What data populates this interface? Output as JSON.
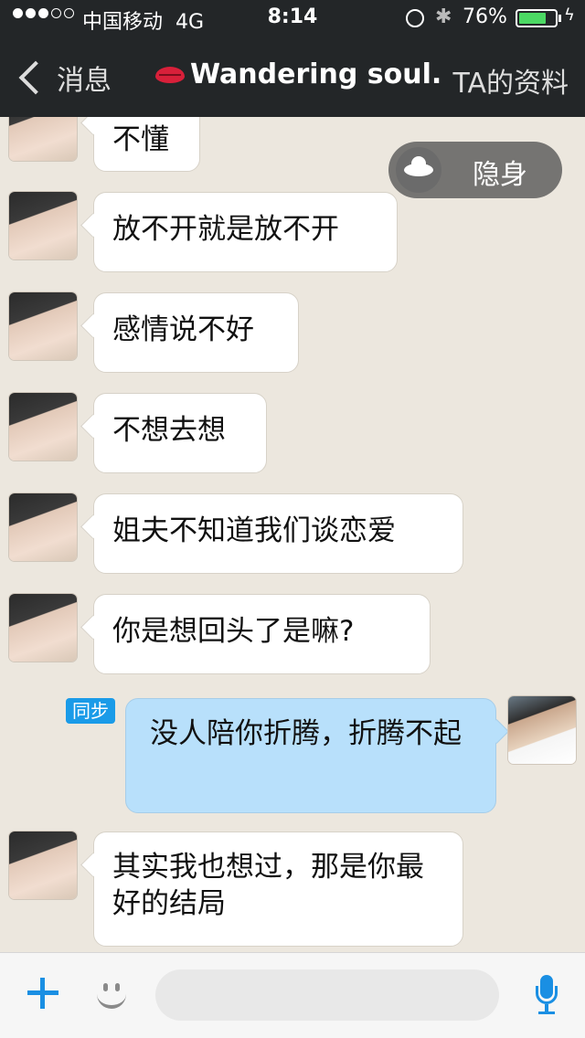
{
  "status_bar": {
    "carrier": "中国移动",
    "network": "4G",
    "time": "8:14",
    "battery": "76%",
    "battery_level": 0.76,
    "signal_bars": 3,
    "signal_total": 5
  },
  "nav": {
    "back_label": "消息",
    "title": "Wandering soul.",
    "right_label": "TA的资料"
  },
  "stealth_label": "隐身",
  "sync_badge": "同步",
  "messages": [
    {
      "side": "left",
      "text": "不懂"
    },
    {
      "side": "left",
      "text": "放不开就是放不开"
    },
    {
      "side": "left",
      "text": "感情说不好"
    },
    {
      "side": "left",
      "text": "不想去想"
    },
    {
      "side": "left",
      "text": "姐夫不知道我们谈恋爱"
    },
    {
      "side": "left",
      "text": "你是想回头了是嘛?"
    },
    {
      "side": "right",
      "text": "没人陪你折腾，折腾不起"
    },
    {
      "side": "left",
      "text": "其实我也想过，那是你最好的结局"
    }
  ],
  "colors": {
    "nav_bg": "#232628",
    "chat_bg": "#ece7de",
    "outgoing_bubble": "#b8e0fb",
    "accent": "#1a8fe3"
  }
}
